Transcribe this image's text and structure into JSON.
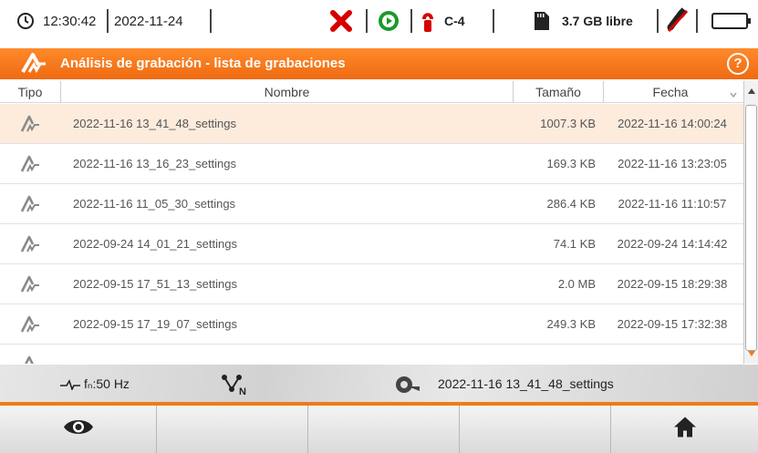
{
  "status_bar": {
    "time": "12:30:42",
    "date": "2022-11-24",
    "clamp_label": "C-4",
    "storage_free": "3.7 GB libre"
  },
  "titlebar": {
    "title": "Análisis de grabación - lista de grabaciones",
    "help_label": "?"
  },
  "table": {
    "headers": {
      "type": "Tipo",
      "name": "Nombre",
      "size": "Tamaño",
      "date": "Fecha"
    },
    "rows": [
      {
        "name": "2022-11-16 13_41_48_settings",
        "size": "1007.3 KB",
        "date": "2022-11-16 14:00:24",
        "selected": true
      },
      {
        "name": "2022-11-16 13_16_23_settings",
        "size": "169.3 KB",
        "date": "2022-11-16 13:23:05",
        "selected": false
      },
      {
        "name": "2022-11-16 11_05_30_settings",
        "size": "286.4 KB",
        "date": "2022-11-16 11:10:57",
        "selected": false
      },
      {
        "name": "2022-09-24 14_01_21_settings",
        "size": "74.1 KB",
        "date": "2022-09-24 14:14:42",
        "selected": false
      },
      {
        "name": "2022-09-15 17_51_13_settings",
        "size": "2.0 MB",
        "date": "2022-09-15 18:29:38",
        "selected": false
      },
      {
        "name": "2022-09-15 17_19_07_settings",
        "size": "249.3 KB",
        "date": "2022-09-15 17:32:38",
        "selected": false
      }
    ]
  },
  "info_bar": {
    "frequency": "fₙ:50 Hz",
    "config_file": "2022-11-16 13_41_48_settings"
  },
  "bottom_buttons": [
    {
      "name": "view",
      "icon": "eye-icon"
    },
    {
      "name": "empty-2",
      "icon": ""
    },
    {
      "name": "empty-3",
      "icon": ""
    },
    {
      "name": "empty-4",
      "icon": ""
    },
    {
      "name": "home",
      "icon": "home-icon"
    }
  ],
  "colors": {
    "accent": "#f07a1c",
    "selected_row": "#fdebdc",
    "stop_red": "#d60000",
    "play_green": "#1a9a2a"
  }
}
